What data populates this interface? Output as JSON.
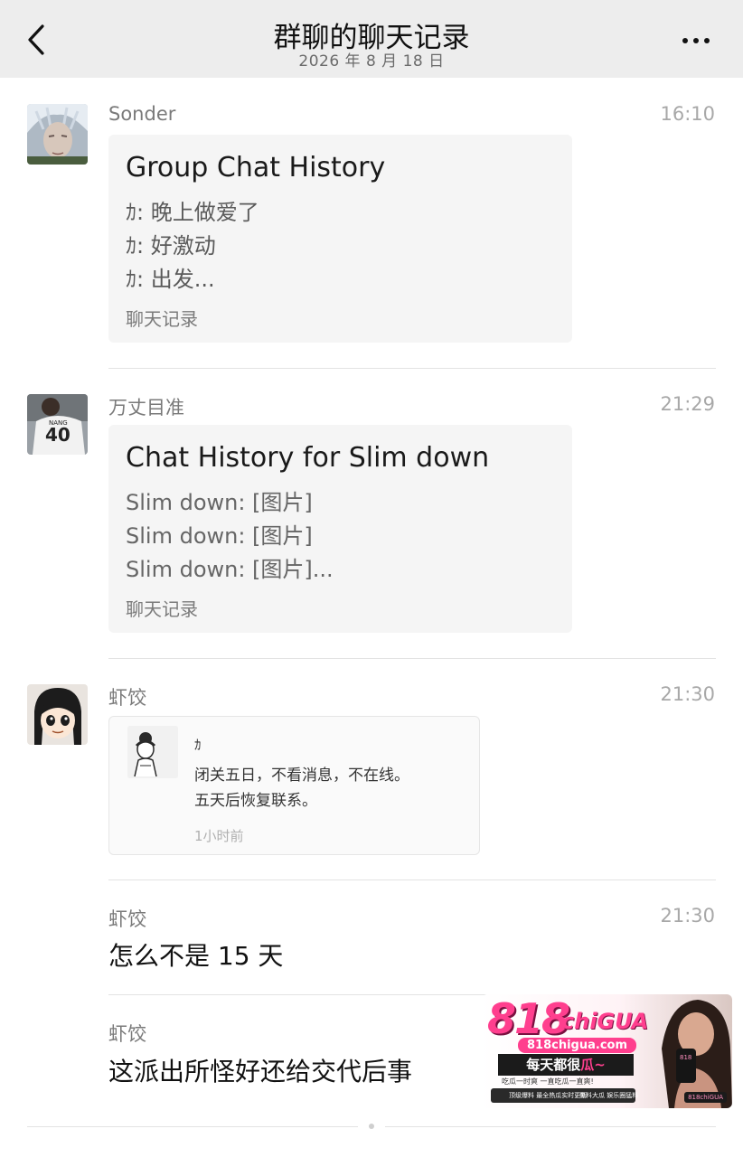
{
  "header": {
    "title": "群聊的聊天记录",
    "subtitle": "2026 年 8 月 18 日",
    "back_icon": "chevron-left-icon",
    "more_icon": "more-dots-icon",
    "bg_color": "#ededed"
  },
  "messages": [
    {
      "sender": "Sonder",
      "time": "16:10",
      "card": {
        "title": "Group Chat History",
        "lines": [
          "ｶ: 晚上做爱了",
          "ｶ: 好激动",
          "ｶ: 出发..."
        ],
        "footer": "聊天记录"
      }
    },
    {
      "sender": "万丈目准",
      "time": "21:29",
      "card": {
        "title": "Chat History for Slim down",
        "lines": [
          "Slim down: [图片]",
          "Slim down: [图片]",
          "Slim down: [图片]..."
        ],
        "footer": "聊天记录"
      }
    },
    {
      "sender": "虾饺",
      "time": "21:30",
      "quote": {
        "name": "ｶ",
        "lines": [
          "闭关五日，不看消息，不在线。",
          "五天后恢复联系。"
        ],
        "time": "1小时前"
      }
    },
    {
      "sender": "虾饺",
      "time": "21:30",
      "text": "怎么不是 15 天"
    },
    {
      "sender": "虾饺",
      "text": "这派出所怪好还给交代后事"
    }
  ],
  "ad": {
    "logo": "818",
    "brand": "chiGUA",
    "url": "818chigua.com",
    "slogan_prefix": "每天都很",
    "slogan_accent": "瓜~",
    "sub": "吃瓜一时爽 一直吃瓜一直爽!",
    "b1": "顶级爆料 最全热瓜实时更新",
    "b2": "黑料大瓜 娱乐圈猛料",
    "tag": "818chiGUA",
    "accent_color": "#ff3f8e"
  }
}
